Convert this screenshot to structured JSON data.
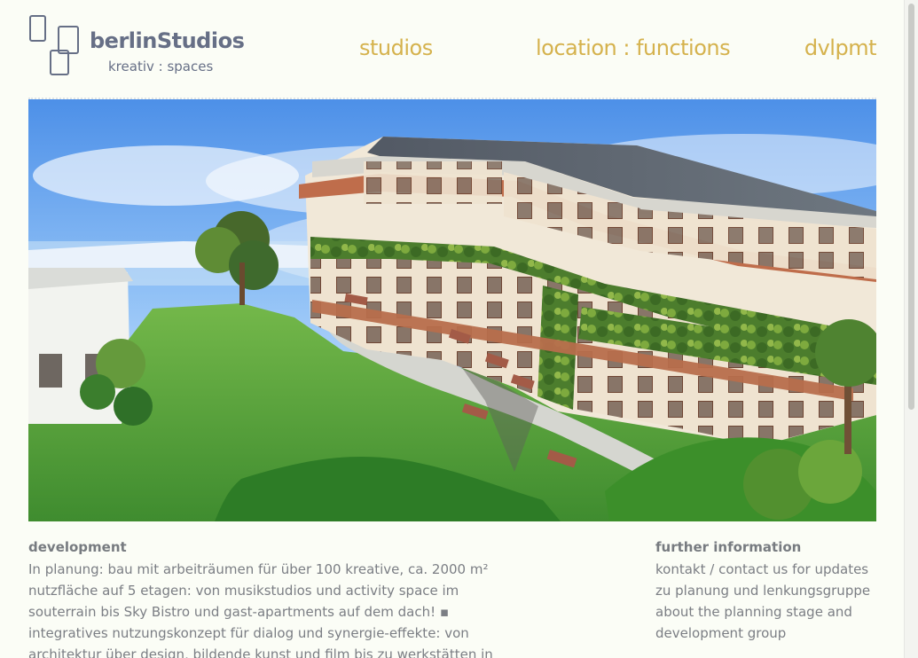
{
  "logo": {
    "name": "berlinStudios",
    "tagline": "kreativ : spaces"
  },
  "nav": {
    "studios": "studios",
    "location": "location : functions",
    "dvlpmt": "dvlpmt"
  },
  "development": {
    "title": "development",
    "body": "In planung: bau mit arbeiträumen für über 100 kreative, ca. 2000 m² nutzfläche auf 5 etagen: von musikstudios und activity space im souterrain bis Sky Bistro und gast-apartments auf dem dach! ▪ integratives nutzungskonzept für dialog und synergie-effekte: von architektur über design, bildende kunst und film bis zu werkstätten in flexiblen raumformaten + fitness ▪ grün angebunden am"
  },
  "further_information": {
    "title": "further information",
    "link_text": "kontakt / contact us",
    "body": " for updates zu planung und lenkungsgruppe about the planning stage and development group"
  },
  "colors": {
    "background": "#fbfdf6",
    "nav": "#d5b24d",
    "logo": "#666f86",
    "text": "#7b7e84"
  },
  "icons": {
    "logo_mark": "stacked-rounded-rectangles-icon"
  }
}
